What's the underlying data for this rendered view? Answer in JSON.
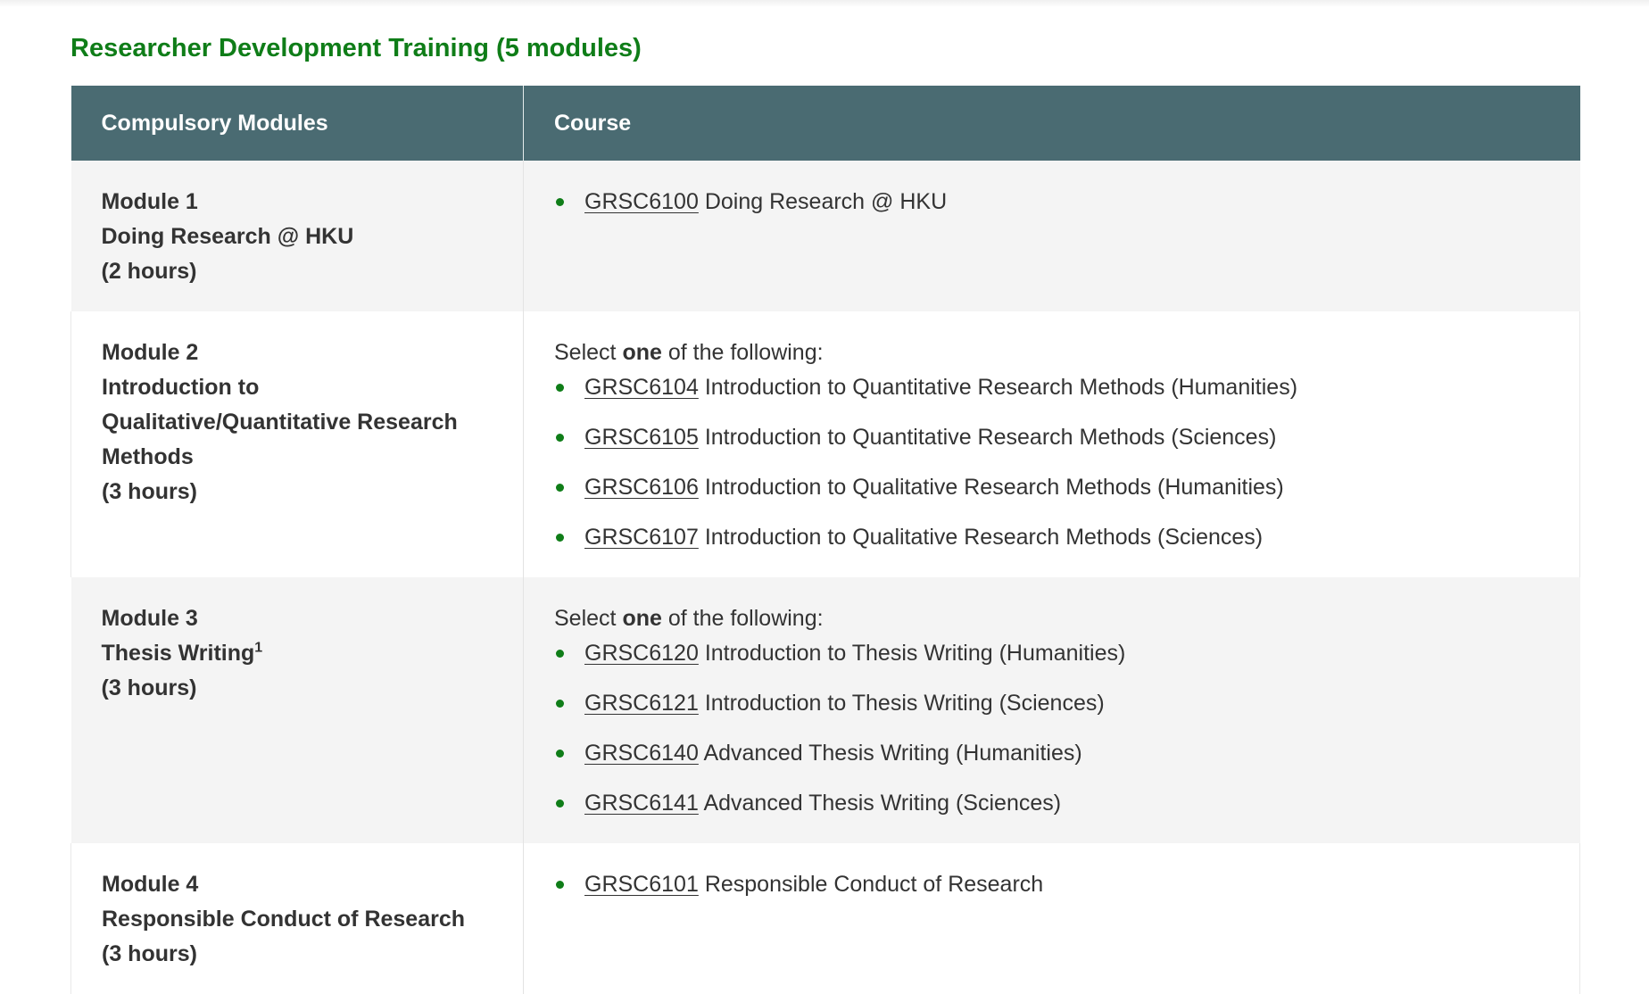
{
  "section_title": "Researcher Development Training (5 modules)",
  "table": {
    "headers": [
      "Compulsory Modules",
      "Course"
    ],
    "rows": [
      {
        "module_lines": [
          "Module 1",
          "Doing Research @ HKU",
          "(2 hours)"
        ],
        "select_prefix": "",
        "select_bold": "",
        "select_suffix": "",
        "courses": [
          {
            "code": "GRSC6100",
            "title": "Doing Research @ HKU"
          }
        ]
      },
      {
        "module_lines": [
          "Module 2",
          "Introduction to",
          "Qualitative/Quantitative Research",
          "Methods",
          "(3 hours)"
        ],
        "select_prefix": "Select ",
        "select_bold": "one",
        "select_suffix": " of the following:",
        "courses": [
          {
            "code": "GRSC6104",
            "title": "Introduction to Quantitative Research Methods (Humanities)"
          },
          {
            "code": "GRSC6105",
            "title": "Introduction to Quantitative Research Methods (Sciences)"
          },
          {
            "code": "GRSC6106",
            "title": "Introduction to Qualitative Research Methods (Humanities)"
          },
          {
            "code": "GRSC6107",
            "title": "Introduction to Qualitative Research Methods (Sciences)"
          }
        ]
      },
      {
        "module_lines": [
          "Module 3",
          "Thesis Writing",
          "(3 hours)"
        ],
        "module_footnote": "1",
        "select_prefix": "Select ",
        "select_bold": "one",
        "select_suffix": " of the following:",
        "courses": [
          {
            "code": "GRSC6120",
            "title": "Introduction to Thesis Writing (Humanities)"
          },
          {
            "code": "GRSC6121",
            "title": "Introduction to Thesis Writing (Sciences)"
          },
          {
            "code": "GRSC6140",
            "title": "Advanced Thesis Writing (Humanities)"
          },
          {
            "code": "GRSC6141",
            "title": "Advanced Thesis Writing (Sciences)"
          }
        ]
      },
      {
        "module_lines": [
          "Module 4",
          "Responsible Conduct of Research",
          "(3 hours)"
        ],
        "select_prefix": "",
        "select_bold": "",
        "select_suffix": "",
        "courses": [
          {
            "code": "GRSC6101",
            "title": "Responsible Conduct of Research"
          }
        ]
      }
    ]
  },
  "colors": {
    "accent_green": "#0f7d18",
    "header_bg": "#4a6b72",
    "row_grey": "#f4f4f4",
    "text": "#333333"
  }
}
